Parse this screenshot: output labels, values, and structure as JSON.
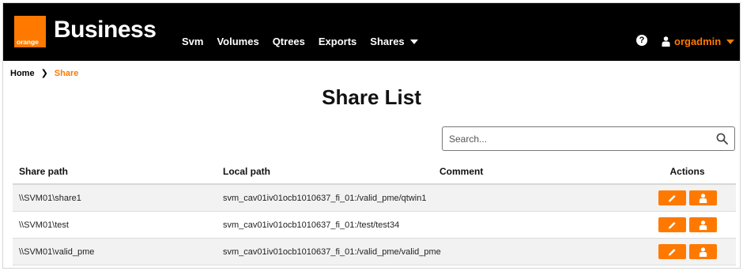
{
  "brand": {
    "logo_text": "orange",
    "title": "Business",
    "accent": "#ff7900"
  },
  "nav": {
    "items": [
      {
        "label": "Svm"
      },
      {
        "label": "Volumes"
      },
      {
        "label": "Qtrees"
      },
      {
        "label": "Exports"
      },
      {
        "label": "Shares"
      }
    ],
    "help_icon": "question-circle-icon",
    "user": {
      "name": "orgadmin",
      "icon": "user-icon"
    }
  },
  "breadcrumb": {
    "home": "Home",
    "current": "Share"
  },
  "page": {
    "title": "Share List"
  },
  "search": {
    "placeholder": "Search...",
    "value": ""
  },
  "table": {
    "headers": {
      "share_path": "Share path",
      "local_path": "Local path",
      "comment": "Comment",
      "actions": "Actions"
    },
    "rows": [
      {
        "share_path": "\\\\SVM01\\share1",
        "local_path": "svm_cav01iv01ocb1010637_fi_01:/valid_pme/qtwin1",
        "comment": ""
      },
      {
        "share_path": "\\\\SVM01\\test",
        "local_path": "svm_cav01iv01ocb1010637_fi_01:/test/test34",
        "comment": ""
      },
      {
        "share_path": "\\\\SVM01\\valid_pme",
        "local_path": "svm_cav01iv01ocb1010637_fi_01:/valid_pme/valid_pme",
        "comment": ""
      }
    ],
    "action_icons": [
      "pencil-icon",
      "user-icon"
    ]
  }
}
